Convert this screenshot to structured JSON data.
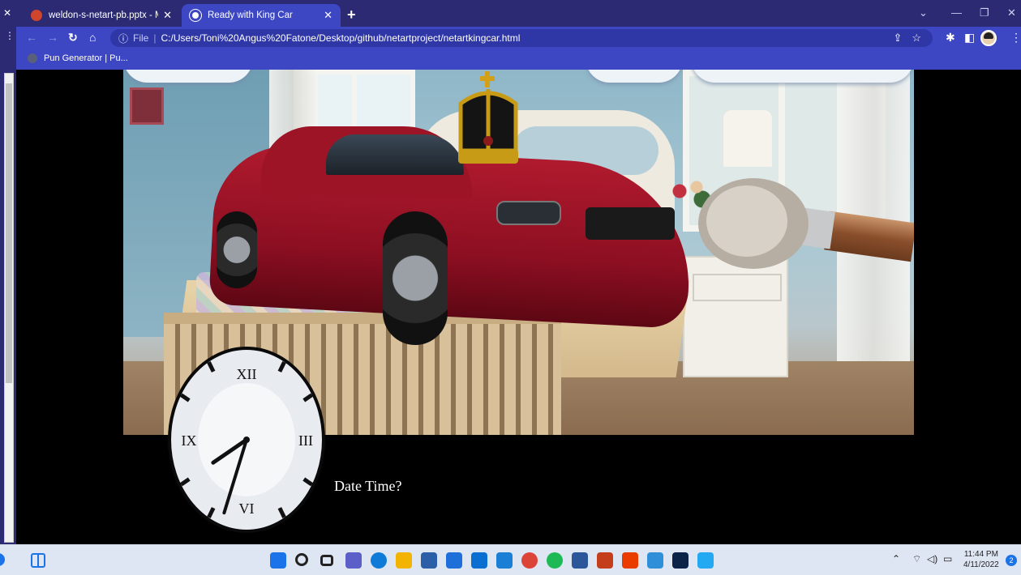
{
  "browser": {
    "tabs": [
      {
        "title": "weldon-s-netart-pb.pptx - Micro",
        "active": false
      },
      {
        "title": "Ready with King Car",
        "active": true
      }
    ],
    "address": {
      "scheme_label": "File",
      "url": "C:/Users/Toni%20Angus%20Fatone/Desktop/github/netartproject/netartkingcar.html"
    },
    "bookmarks": [
      {
        "label": "Pun Generator | Pu..."
      }
    ]
  },
  "page": {
    "date_time_text": "Date Time?",
    "clock": {
      "numerals": [
        "XII",
        "III",
        "VI",
        "IX"
      ],
      "hour_hand_angle_deg": 240,
      "minute_hand_angle_deg": 200
    }
  },
  "taskbar": {
    "time": "11:44 PM",
    "date": "4/11/2022",
    "notification_count": "2",
    "icons": [
      "start-icon",
      "search-icon",
      "task-view-icon",
      "teams-icon",
      "edge-icon",
      "file-explorer-icon",
      "store-icon",
      "mail-icon",
      "app-icon",
      "app-icon-2",
      "chrome-icon",
      "spotify-icon",
      "word-icon",
      "powerpoint-icon",
      "office-icon",
      "app-icon-3",
      "photoshop-icon",
      "vscode-icon"
    ]
  },
  "colors": {
    "tab_bar": "#2b2a73",
    "toolbar": "#3d47c3",
    "page_bg": "#000000",
    "taskbar": "#dfe6f3"
  }
}
